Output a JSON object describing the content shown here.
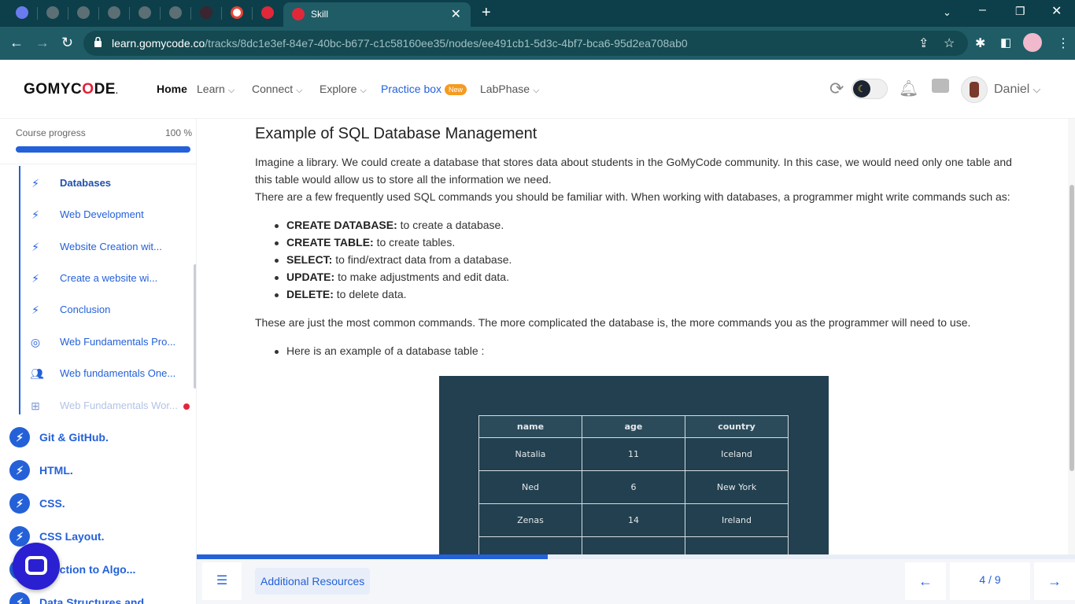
{
  "browser": {
    "tab_title": "Skill",
    "url_host": "learn.gomycode.co",
    "url_path": "/tracks/8dc1e3ef-84e7-40bc-b677-c1c58160ee35/nodes/ee491cb1-5d3c-4bf7-bca6-95d2ea708ab0",
    "icons": [
      "back-icon",
      "forward-icon",
      "reload-icon",
      "lock-icon",
      "share-icon",
      "bookmark-star-icon",
      "extensions-icon",
      "side-panel-icon",
      "profile-icon"
    ]
  },
  "header": {
    "logo_prefix": "GOMYC",
    "logo_o": "O",
    "logo_suffix": "DE",
    "logo_mark": ".",
    "nav": {
      "home": "Home",
      "learn": "Learn",
      "connect": "Connect",
      "explore": "Explore",
      "practice": "Practice box",
      "new_badge": "New",
      "labphase": "LabPhase"
    },
    "user_name": "Daniel"
  },
  "sidebar": {
    "progress_label": "Course progress",
    "progress_value": "100 %",
    "progress_fraction": 1.0,
    "lessons": [
      {
        "label": "Databases",
        "icon": "bolt-icon",
        "state": "active"
      },
      {
        "label": "Web Development",
        "icon": "bolt-icon",
        "state": "normal"
      },
      {
        "label": "Website Creation wit...",
        "icon": "bolt-icon",
        "state": "normal"
      },
      {
        "label": "Create a website wi...",
        "icon": "bolt-icon",
        "state": "normal"
      },
      {
        "label": "Conclusion",
        "icon": "bolt-icon",
        "state": "normal"
      },
      {
        "label": "Web Fundamentals Pro...",
        "icon": "target-icon",
        "state": "normal"
      },
      {
        "label": "Web fundamentals One...",
        "icon": "people-icon",
        "state": "normal"
      },
      {
        "label": "Web Fundamentals Wor...",
        "icon": "workshop-icon",
        "state": "locked"
      }
    ],
    "modules": [
      {
        "label": "Git & GitHub."
      },
      {
        "label": "HTML."
      },
      {
        "label": "CSS."
      },
      {
        "label": "CSS Layout."
      },
      {
        "label": "oduction to Algo..."
      },
      {
        "label": "Data Structures and"
      }
    ]
  },
  "content": {
    "title": "Example of SQL Database Management",
    "paragraph_1": "Imagine a library. We could create a database that stores data about students in the GoMyCode community. In this case, we would need only one table and this table would allow us to store all the information we need.",
    "paragraph_2": "There are a few frequently used SQL commands you should be familiar with. When working with databases, a programmer might write commands such as:",
    "commands": [
      {
        "name": "CREATE DATABASE:",
        "desc": " to create a database."
      },
      {
        "name": "CREATE TABLE:",
        "desc": " to create tables."
      },
      {
        "name": "SELECT:",
        "desc": " to find/extract data from a database."
      },
      {
        "name": "UPDATE:",
        "desc": " to make adjustments and edit data."
      },
      {
        "name": "DELETE:",
        "desc": " to delete data."
      }
    ],
    "paragraph_3": "These are just the most common commands. The more complicated the database is, the more commands you as the programmer will need to use.",
    "example_bullet": "Here is an example of a database table :",
    "table": {
      "headers": [
        "name",
        "age",
        "country"
      ],
      "rows": [
        [
          "Natalia",
          "11",
          "Iceland"
        ],
        [
          "Ned",
          "6",
          "New York"
        ],
        [
          "Zenas",
          "14",
          "Ireland"
        ],
        [
          "",
          "",
          ""
        ]
      ]
    }
  },
  "footer": {
    "additional_resources": "Additional Resources",
    "page_counter": "4 / 9",
    "reading_progress_fraction": 0.4
  },
  "colors": {
    "brand_blue": "#2461d9",
    "logo_red": "#e21f38",
    "badge_orange": "#f59b1f",
    "image_bg": "#22404f"
  }
}
